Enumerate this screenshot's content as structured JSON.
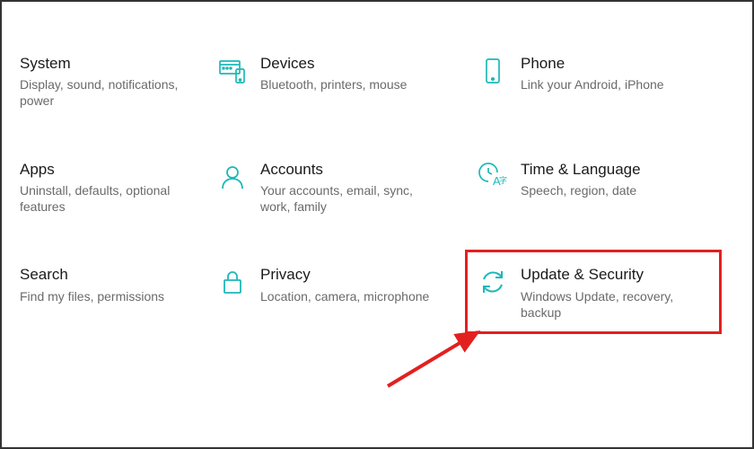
{
  "accent_color": "#1eb8b8",
  "highlight_color": "#e22020",
  "tiles": {
    "system": {
      "title": "System",
      "desc": "Display, sound, notifications, power"
    },
    "devices": {
      "title": "Devices",
      "desc": "Bluetooth, printers, mouse"
    },
    "phone": {
      "title": "Phone",
      "desc": "Link your Android, iPhone"
    },
    "apps": {
      "title": "Apps",
      "desc": "Uninstall, defaults, optional features"
    },
    "accounts": {
      "title": "Accounts",
      "desc": "Your accounts, email, sync, work, family"
    },
    "timelang": {
      "title": "Time & Language",
      "desc": "Speech, region, date"
    },
    "search": {
      "title": "Search",
      "desc": "Find my files, permissions"
    },
    "privacy": {
      "title": "Privacy",
      "desc": "Location, camera, microphone"
    },
    "update": {
      "title": "Update & Security",
      "desc": "Windows Update, recovery, backup"
    }
  }
}
